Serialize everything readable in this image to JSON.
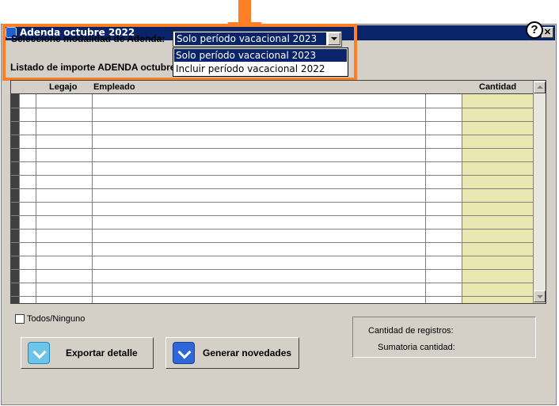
{
  "window": {
    "title": "Adenda octubre 2022"
  },
  "help": {
    "label": "?"
  },
  "modalidad": {
    "label": "Seleccione modalidad de Adenda:",
    "selected": "Solo período vacacional 2023",
    "options": [
      "Solo período vacacional 2023",
      "Incluir período vacacional 2022"
    ]
  },
  "listado": {
    "label": "Listado de importe ADENDA octubre"
  },
  "grid": {
    "columns": {
      "legajo": "Legajo",
      "empleado": "Empleado",
      "blank": "",
      "cantidad": "Cantidad"
    }
  },
  "todos": {
    "label": "Todos/Ninguno"
  },
  "buttons": {
    "exportar": "Exportar detalle",
    "generar": "Generar novedades"
  },
  "stats": {
    "registros_label": "Cantidad de registros:",
    "sumatoria_label": "Sumatoria cantidad:"
  },
  "colors": {
    "highlight": "#ff7f27",
    "title_bar": "#0a246a",
    "cantidad_fill": "#e8e8b0"
  }
}
